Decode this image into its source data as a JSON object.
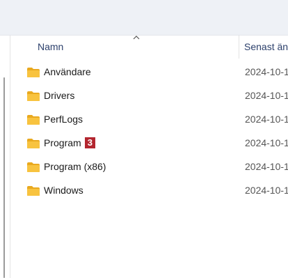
{
  "columns": {
    "name": "Namn",
    "date": "Senast änd"
  },
  "rows": [
    {
      "name": "Användare",
      "date": "2024-10-1",
      "icon": "folder-icon"
    },
    {
      "name": "Drivers",
      "date": "2024-10-1",
      "icon": "folder-icon"
    },
    {
      "name": "PerfLogs",
      "date": "2024-10-1",
      "icon": "folder-icon"
    },
    {
      "name": "Program",
      "badge": "3",
      "date": "2024-10-1",
      "icon": "folder-icon"
    },
    {
      "name": "Program (x86)",
      "date": "2024-10-1",
      "icon": "folder-icon"
    },
    {
      "name": "Windows",
      "date": "2024-10-1",
      "icon": "folder-icon"
    }
  ],
  "colors": {
    "folder": "#f8c33f",
    "badge": "#b3262f",
    "header_text": "#2b3f6b"
  }
}
